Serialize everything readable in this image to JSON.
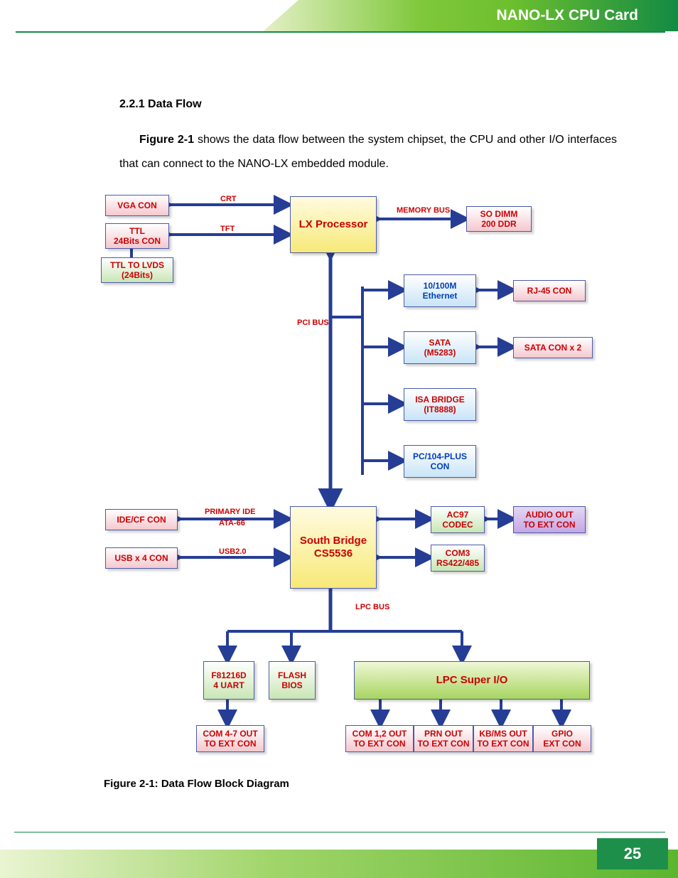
{
  "header": {
    "title": "NANO-LX CPU Card"
  },
  "footer": {
    "page": "25"
  },
  "section": {
    "number": "2.2.1 Data Flow"
  },
  "paragraph": {
    "lead": "Figure 2-1",
    "rest": " shows the data flow between the system chipset, the CPU and other I/O interfaces that can connect to the NANO-LX embedded module."
  },
  "caption": "Figure 2-1: Data Flow Block Diagram",
  "blocks": {
    "vga": "VGA CON",
    "ttl": "TTL\n24Bits CON",
    "lvds": "TTL TO LVDS\n(24Bits)",
    "proc": "LX Processor",
    "sodimm": "SO DIMM\n200 DDR",
    "eth": "10/100M\nEthernet",
    "rj45": "RJ-45 CON",
    "sata": "SATA\n(M5283)",
    "satacon": "SATA CON x 2",
    "isa": "ISA BRIDGE\n(IT8888)",
    "pc104": "PC/104-PLUS\nCON",
    "idecf": "IDE/CF CON",
    "usb": "USB x 4 CON",
    "sb": "South Bridge\nCS5536",
    "ac97": "AC97\nCODEC",
    "audio": "AUDIO OUT\nTO EXT CON",
    "com3": "COM3\nRS422/485",
    "uart": "F81216D\n4 UART",
    "bios": "FLASH\nBIOS",
    "lpc": "LPC Super I/O",
    "com47": "COM 4-7 OUT\nTO EXT CON",
    "com12": "COM 1,2 OUT\nTO EXT CON",
    "prn": "PRN OUT\nTO EXT CON",
    "kbms": "KB/MS OUT\nTO EXT CON",
    "gpio": "GPIO\nEXT CON"
  },
  "labels": {
    "crt": "CRT",
    "tft": "TFT",
    "mem": "MEMORY BUS",
    "pci": "PCI BUS",
    "pide": "PRIMARY IDE",
    "ata": "ATA-66",
    "usb20": "USB2.0",
    "lpcbus": "LPC BUS"
  }
}
